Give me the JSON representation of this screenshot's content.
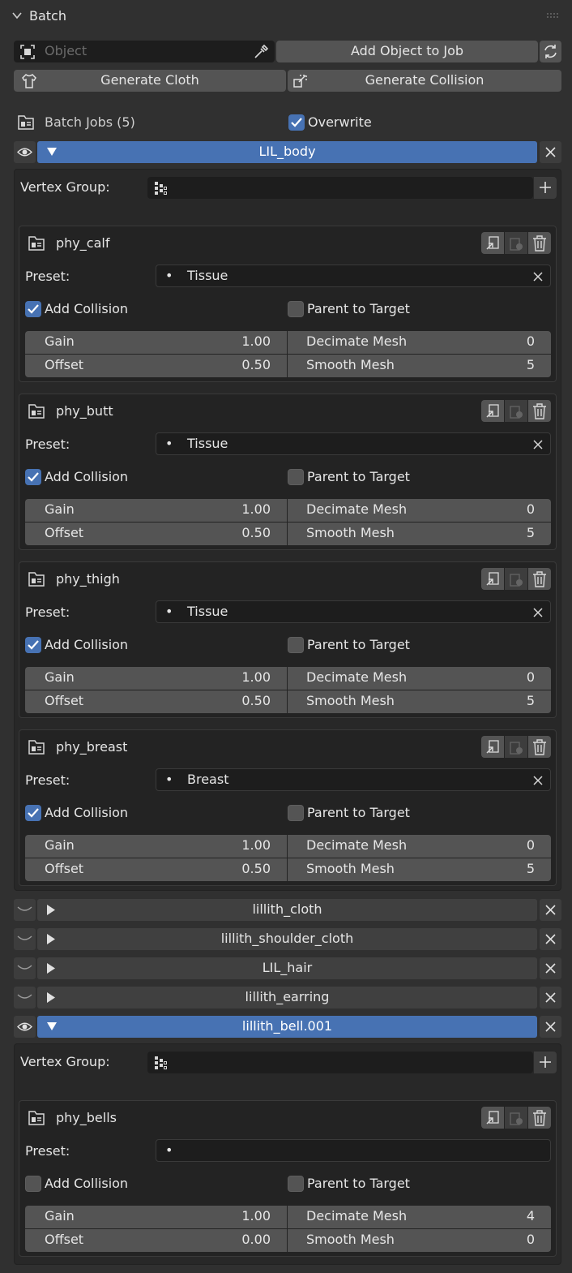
{
  "header": {
    "title": "Batch"
  },
  "toolbar": {
    "object_placeholder": "Object",
    "add_object_label": "Add Object to Job",
    "generate_cloth_label": "Generate Cloth",
    "generate_collision_label": "Generate Collision"
  },
  "jobs_header": {
    "label": "Batch Jobs (5)",
    "overwrite_label": "Overwrite",
    "overwrite_checked": true
  },
  "labels": {
    "vertex_group": "Vertex Group:",
    "preset": "Preset:",
    "add_collision": "Add Collision",
    "parent_to_target": "Parent to Target",
    "gain": "Gain",
    "offset": "Offset",
    "decimate_mesh": "Decimate Mesh",
    "smooth_mesh": "Smooth Mesh",
    "bullet": "•"
  },
  "jobs": [
    {
      "name": "LIL_body",
      "expanded": true,
      "items": [
        {
          "name": "phy_calf",
          "preset": "Tissue",
          "add_collision": true,
          "parent_to_target": false,
          "gain": "1.00",
          "offset": "0.50",
          "decimate": "0",
          "smooth": "5"
        },
        {
          "name": "phy_butt",
          "preset": "Tissue",
          "add_collision": true,
          "parent_to_target": false,
          "gain": "1.00",
          "offset": "0.50",
          "decimate": "0",
          "smooth": "5"
        },
        {
          "name": "phy_thigh",
          "preset": "Tissue",
          "add_collision": true,
          "parent_to_target": false,
          "gain": "1.00",
          "offset": "0.50",
          "decimate": "0",
          "smooth": "5"
        },
        {
          "name": "phy_breast",
          "preset": "Breast",
          "add_collision": true,
          "parent_to_target": false,
          "gain": "1.00",
          "offset": "0.50",
          "decimate": "0",
          "smooth": "5"
        }
      ]
    },
    {
      "name": "lillith_cloth",
      "expanded": false
    },
    {
      "name": "lillith_shoulder_cloth",
      "expanded": false
    },
    {
      "name": "LIL_hair",
      "expanded": false
    },
    {
      "name": "lillith_earring",
      "expanded": false
    },
    {
      "name": "lillith_bell.001",
      "expanded": true,
      "items": [
        {
          "name": "phy_bells",
          "preset": "",
          "add_collision": false,
          "parent_to_target": false,
          "gain": "1.00",
          "offset": "0.00",
          "decimate": "4",
          "smooth": "0"
        }
      ]
    }
  ],
  "colors": {
    "accent": "#4772b3",
    "background": "#303030",
    "field": "#1d1d1d",
    "button": "#545454"
  }
}
